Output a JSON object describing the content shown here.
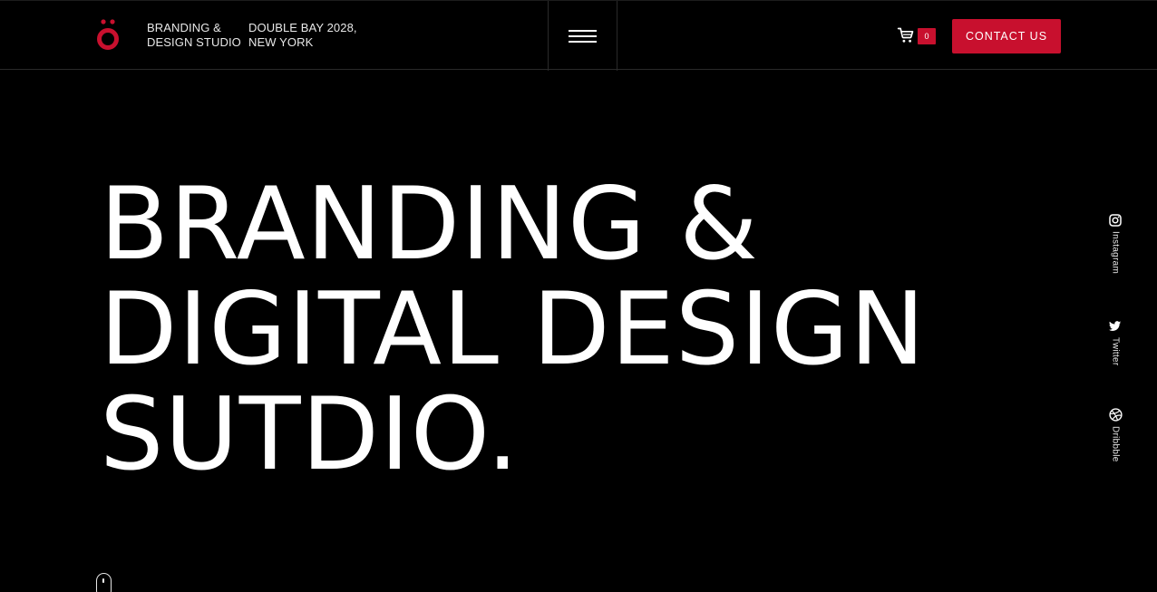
{
  "header": {
    "studio_line1": "BRANDING &",
    "studio_line2": "DESIGN STUDIO",
    "address_line1": "DOUBLE BAY 2028,",
    "address_line2": "NEW YORK",
    "cart_count": "0",
    "contact_label": "CONTACT US",
    "logo_icon": "o-umlaut-logo",
    "menu_icon": "hamburger-menu-icon",
    "cart_icon": "shopping-cart-icon"
  },
  "hero": {
    "line1": "BRANDING &",
    "line2": "DIGITAL DESIGN",
    "line3": "SUTDIO."
  },
  "social": {
    "instagram": "Instagram",
    "twitter": "Twitter",
    "dribbble": "Dribbble"
  },
  "colors": {
    "background": "#000000",
    "accent": "#c8102e",
    "text": "#ffffff"
  }
}
